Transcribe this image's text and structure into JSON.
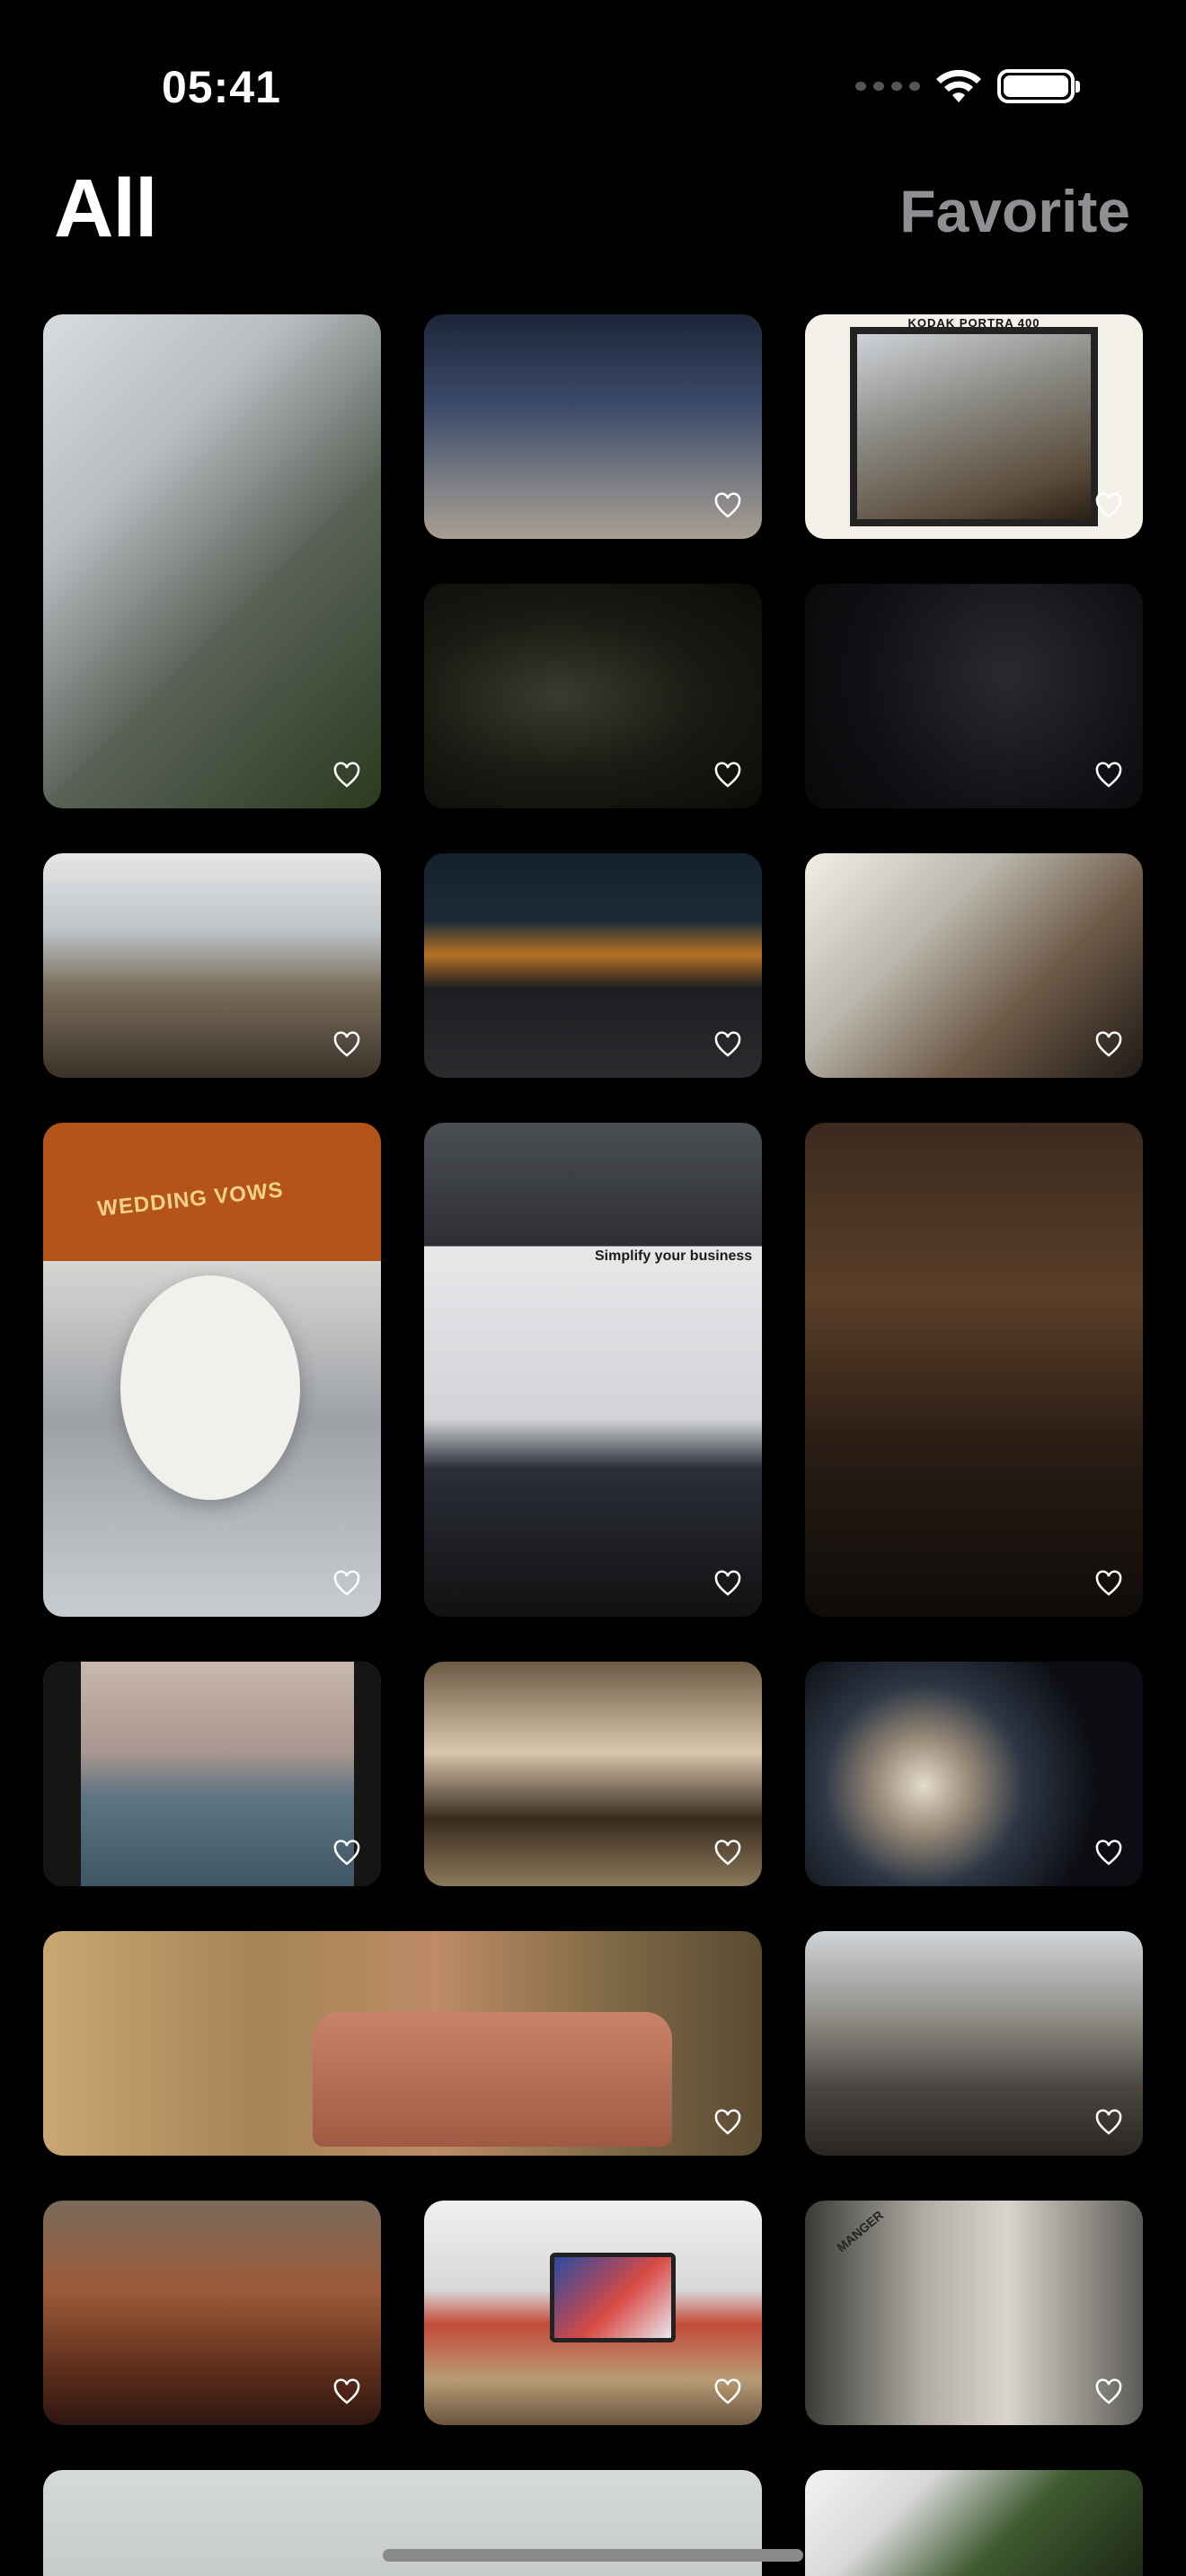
{
  "status_bar": {
    "time": "05:41"
  },
  "header": {
    "title": "All",
    "favorite_tab": "Favorite"
  },
  "photos": [
    {
      "name": "photo-greenhouse-hand",
      "favorite": false
    },
    {
      "name": "photo-city-street",
      "favorite": false
    },
    {
      "name": "photo-film-frame-studio",
      "favorite": false
    },
    {
      "name": "photo-dark-fabric",
      "favorite": false
    },
    {
      "name": "photo-starry-sky",
      "favorite": false
    },
    {
      "name": "photo-window-lake",
      "favorite": false
    },
    {
      "name": "photo-woman-chevrons",
      "favorite": false
    },
    {
      "name": "photo-dog-piano",
      "favorite": false
    },
    {
      "name": "photo-wedding-rings",
      "favorite": false
    },
    {
      "name": "photo-laptop",
      "favorite": false
    },
    {
      "name": "photo-wood-interior",
      "favorite": false
    },
    {
      "name": "photo-venice-window",
      "favorite": false
    },
    {
      "name": "photo-townhouse",
      "favorite": false
    },
    {
      "name": "photo-jellyfish",
      "favorite": false
    },
    {
      "name": "photo-floral-sofa",
      "favorite": false
    },
    {
      "name": "photo-atrium",
      "favorite": false
    },
    {
      "name": "photo-canyon",
      "favorite": false
    },
    {
      "name": "photo-desk-monitor",
      "favorite": false
    },
    {
      "name": "photo-wall-lamp",
      "favorite": false
    },
    {
      "name": "photo-bottom-wide",
      "favorite": false
    },
    {
      "name": "photo-bottom-plants",
      "favorite": false
    }
  ],
  "tile_texts": {
    "film_label": "KODAK PORTRA 400",
    "card_text": "WEDDING VOWS",
    "laptop_text": "Simplify your business",
    "sign_text": "MANGER"
  },
  "icons": {
    "heart": "heart-outline-icon",
    "wifi": "wifi-icon",
    "battery": "battery-icon",
    "signal": "cellular-signal-icon"
  }
}
